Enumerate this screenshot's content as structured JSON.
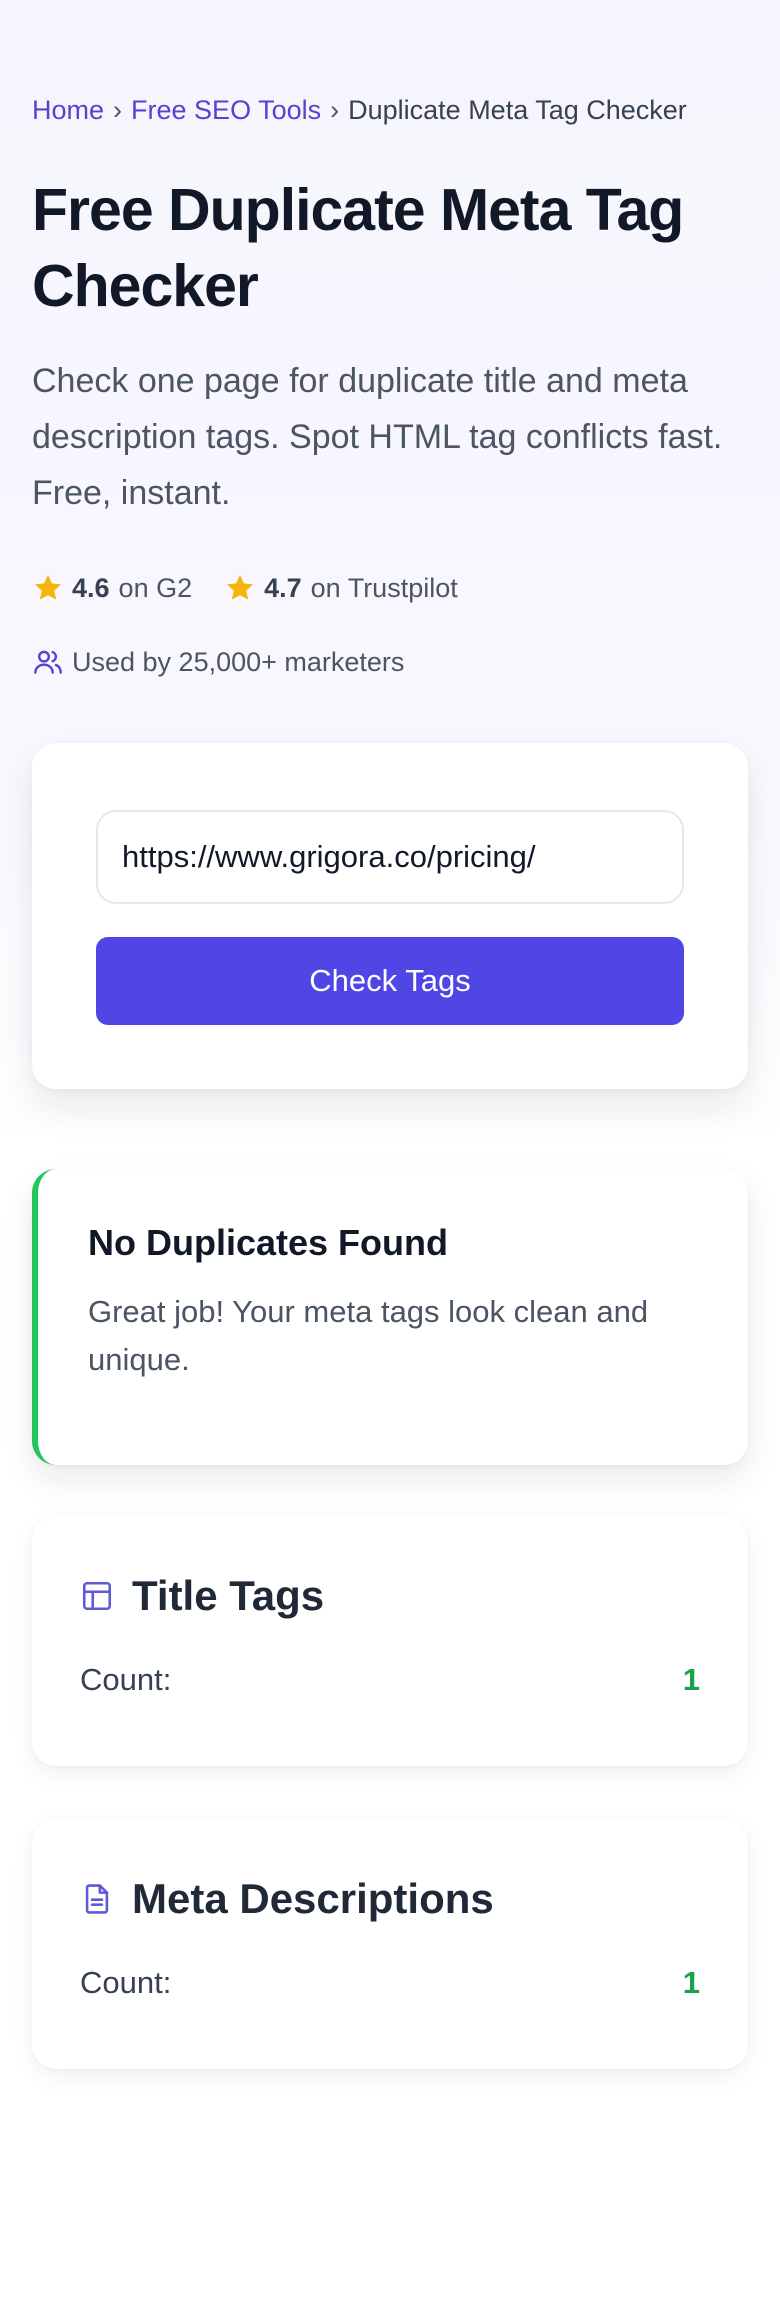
{
  "breadcrumb": {
    "items": [
      "Home",
      "Free SEO Tools"
    ],
    "current": "Duplicate Meta Tag Checker",
    "separator": "›"
  },
  "hero": {
    "title": "Free Duplicate Meta Tag Checker",
    "subtitle": "Check one page for duplicate title and meta description tags. Spot HTML tag conflicts fast. Free, instant."
  },
  "ratings": [
    {
      "score": "4.6",
      "platform": "on G2",
      "icon": "star-icon"
    },
    {
      "score": "4.7",
      "platform": "on Trustpilot",
      "icon": "star-icon"
    }
  ],
  "social_proof": {
    "text": "Used by 25,000+ marketers",
    "icon": "users-icon"
  },
  "form": {
    "url_value": "https://www.grigora.co/pricing/",
    "submit_label": "Check Tags"
  },
  "result": {
    "title": "No Duplicates Found",
    "message": "Great job! Your meta tags look clean and unique.",
    "status_color": "#22c55e"
  },
  "stats": {
    "title_tags": {
      "heading": "Title Tags",
      "count_label": "Count:",
      "count_value": "1",
      "icon": "layout-icon"
    },
    "meta_descriptions": {
      "heading": "Meta Descriptions",
      "count_label": "Count:",
      "count_value": "1",
      "icon": "document-icon"
    }
  },
  "colors": {
    "accent": "#4f46e5",
    "link": "#5b3fd1",
    "star": "#f5b50a",
    "success": "#16a34a"
  }
}
